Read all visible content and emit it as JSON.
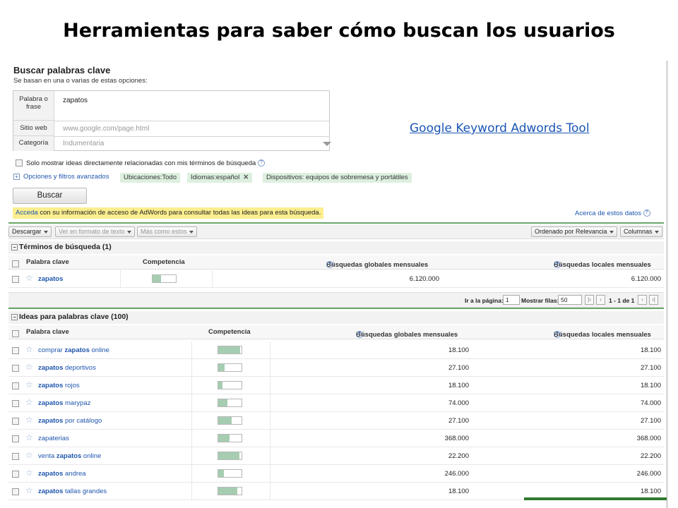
{
  "slide": {
    "title": "Herramientas para saber cómo buscan los usuarios",
    "link_text": "Google Keyword Adwords Tool"
  },
  "search": {
    "title": "Buscar palabras clave",
    "subtitle": "Se basan en una o varias de estas opciones:",
    "fields": {
      "phrase_label": "Palabra o frase",
      "phrase_value": "zapatos",
      "site_label": "Sitio web",
      "site_placeholder": "www.google.com/page.html",
      "category_label": "Categoría",
      "category_value": "Indumentaria"
    },
    "only_related_label": "Solo mostrar ideas directamente relacionadas con mis términos de búsqueda",
    "advanced_options_label": "Opciones y filtros avanzados",
    "filters": [
      "Ubicaciones:Todo",
      "Idiomas:español",
      "Dispositivos: equipos de sobremesa y portátiles"
    ],
    "button_label": "Buscar"
  },
  "notice": {
    "link": "Acceda",
    "text": " con su información de acceso de AdWords para consultar todas las ideas para esta búsqueda.",
    "about_link": "Acerca de estos datos"
  },
  "toolbar": {
    "download": "Descargar",
    "text_view": "Ver en formato de texto",
    "more_like": "Más como estos",
    "sort": "Ordenado por Relevancia",
    "columns": "Columnas"
  },
  "columns": {
    "keyword": "Palabra clave",
    "competition": "Competencia",
    "global": "Búsquedas globales mensuales",
    "local": "Búsquedas locales mensuales"
  },
  "search_terms": {
    "heading": "Términos de búsqueda (1)",
    "rows": [
      {
        "pre": "",
        "bold": "zapatos",
        "post": "",
        "competition": 0.35,
        "global": "6.120.000",
        "local": "6.120.000"
      }
    ]
  },
  "pager": {
    "page_label": "Ir a la página:",
    "page_value": "1",
    "rows_label": "Mostrar filas:",
    "rows_value": "50",
    "range": "1 - 1 de 1"
  },
  "ideas": {
    "heading": "Ideas para palabras clave (100)",
    "rows": [
      {
        "pre": "comprar ",
        "bold": "zapatos",
        "post": " online",
        "competition": 0.95,
        "global": "18.100",
        "local": "18.100"
      },
      {
        "pre": "",
        "bold": "zapatos",
        "post": " deportivos",
        "competition": 0.28,
        "global": "27.100",
        "local": "27.100"
      },
      {
        "pre": "",
        "bold": "zapatos",
        "post": " rojos",
        "competition": 0.18,
        "global": "18.100",
        "local": "18.100"
      },
      {
        "pre": "",
        "bold": "zapatos",
        "post": " marypaz",
        "competition": 0.38,
        "global": "74.000",
        "local": "74.000"
      },
      {
        "pre": "",
        "bold": "zapatos",
        "post": " por catálogo",
        "competition": 0.58,
        "global": "27.100",
        "local": "27.100"
      },
      {
        "pre": "zapaterias",
        "bold": "",
        "post": "",
        "competition": 0.48,
        "global": "368.000",
        "local": "368.000"
      },
      {
        "pre": "venta ",
        "bold": "zapatos",
        "post": " online",
        "competition": 0.92,
        "global": "22.200",
        "local": "22.200"
      },
      {
        "pre": "",
        "bold": "zapatos",
        "post": " andrea",
        "competition": 0.25,
        "global": "246.000",
        "local": "246.000"
      },
      {
        "pre": "",
        "bold": "zapatos",
        "post": " tallas grandes",
        "competition": 0.82,
        "global": "18.100",
        "local": "18.100"
      }
    ]
  }
}
